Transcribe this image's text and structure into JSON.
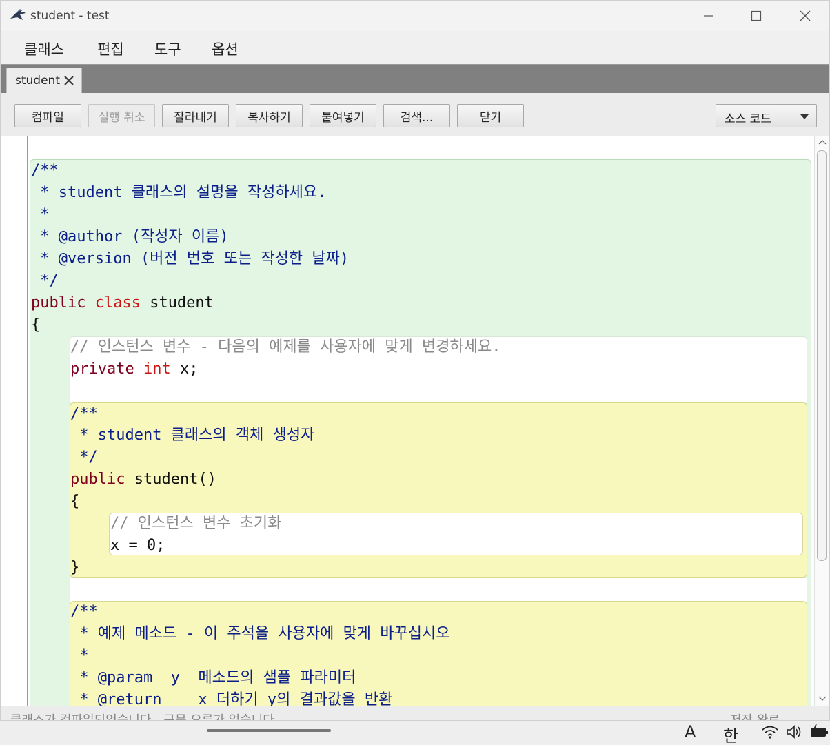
{
  "window": {
    "title": "student - test",
    "controls": [
      "minimize",
      "maximize",
      "close"
    ]
  },
  "menu": [
    "클래스",
    "편집",
    "도구",
    "옵션"
  ],
  "tab": {
    "label": "student"
  },
  "toolbar": {
    "compile": "컴파일",
    "undo": "실행 취소",
    "cut": "잘라내기",
    "copy": "복사하기",
    "paste": "붙여넣기",
    "find": "검색...",
    "close": "닫기",
    "view_selected": "소스 코드"
  },
  "code": {
    "l1": "/**",
    "l2": " * student 클래스의 설명을 작성하세요.",
    "l3": " *",
    "l4": " * @author (작성자 이름)",
    "l5": " * @version (버전 번호 또는 작성한 날짜)",
    "l6": " */",
    "l7_public": "public ",
    "l7_class": "class",
    "l7_name": " student",
    "l8": "{",
    "l9": "// 인스턴스 변수 - 다음의 예제를 사용자에 맞게 변경하세요.",
    "l10_private": "private ",
    "l10_int": "int",
    "l10_rest": " x;",
    "l11": "/**",
    "l12": " * student 클래스의 객체 생성자",
    "l13": " */",
    "l14_public": "public",
    "l14_rest": " student()",
    "l15": "{",
    "l16": "// 인스턴스 변수 초기화",
    "l17": "x = 0;",
    "l18": "}",
    "l19": "/**",
    "l20": " * 예제 메소드 - 이 주석을 사용자에 맞게 바꾸십시오",
    "l21": " *",
    "l22": " * @param  y  메소드의 샘플 파라미터",
    "l23": " * @return    x 더하기 y의 결과값을 반환"
  },
  "status": {
    "message": "클래스가 컴파일되었습니다 - 구문 오류가 없습니다",
    "right": "저장 완료"
  },
  "taskbar": {
    "ime_latin": "A",
    "ime_korean": "한"
  },
  "colors": {
    "class_scope": "#e3f5e3",
    "method_scope": "#f8f8bc",
    "doc_comment": "#0b1e8a",
    "keyword": "#800020",
    "class_keyword": "#cc1111",
    "line_comment": "#8a8a8a"
  }
}
